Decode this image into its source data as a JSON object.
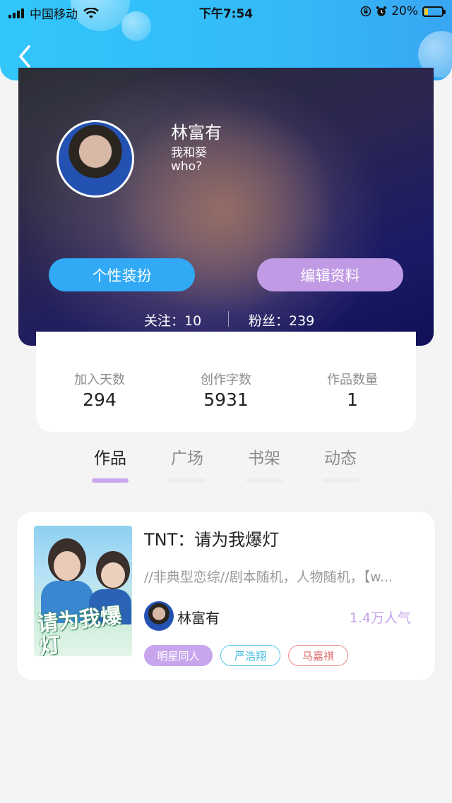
{
  "status_bar": {
    "carrier": "中国移动",
    "time": "下午7:54",
    "battery_percent": "20%",
    "battery_level": 0.2
  },
  "profile": {
    "name": "林富有",
    "bio": "我和葵\nwho?",
    "buttons": {
      "dress_up": "个性装扮",
      "edit_profile": "编辑资料"
    },
    "follow_text": "关注：10",
    "fans_text": "粉丝：239"
  },
  "stats": [
    {
      "label": "加入天数",
      "value": "294"
    },
    {
      "label": "创作字数",
      "value": "5931"
    },
    {
      "label": "作品数量",
      "value": "1"
    }
  ],
  "tabs": [
    {
      "label": "作品",
      "active": true
    },
    {
      "label": "广场",
      "active": false
    },
    {
      "label": "书架",
      "active": false
    },
    {
      "label": "动态",
      "active": false
    }
  ],
  "work": {
    "title": "TNT：请为我爆灯",
    "cover_title": "请为我爆灯",
    "description": "//非典型恋综//剧本随机，人物随机，【w...",
    "author": "林富有",
    "popularity": "1.4万人气",
    "tags": [
      "明星同人",
      "严浩翔",
      "马嘉祺"
    ]
  },
  "colors": {
    "header": "#33baf8",
    "dress_button": "#32a9f5",
    "edit_button": "#c09ae4",
    "active_tab_bar": "#c9a6ee",
    "tag_primary": "#c8a6ee",
    "tag_cyan": "#52c5e8",
    "tag_red": "#ef8a8a"
  },
  "icons": {
    "back": "chevron-left-icon",
    "wifi": "wifi-icon",
    "lock": "rotation-lock-icon",
    "alarm": "alarm-icon"
  }
}
